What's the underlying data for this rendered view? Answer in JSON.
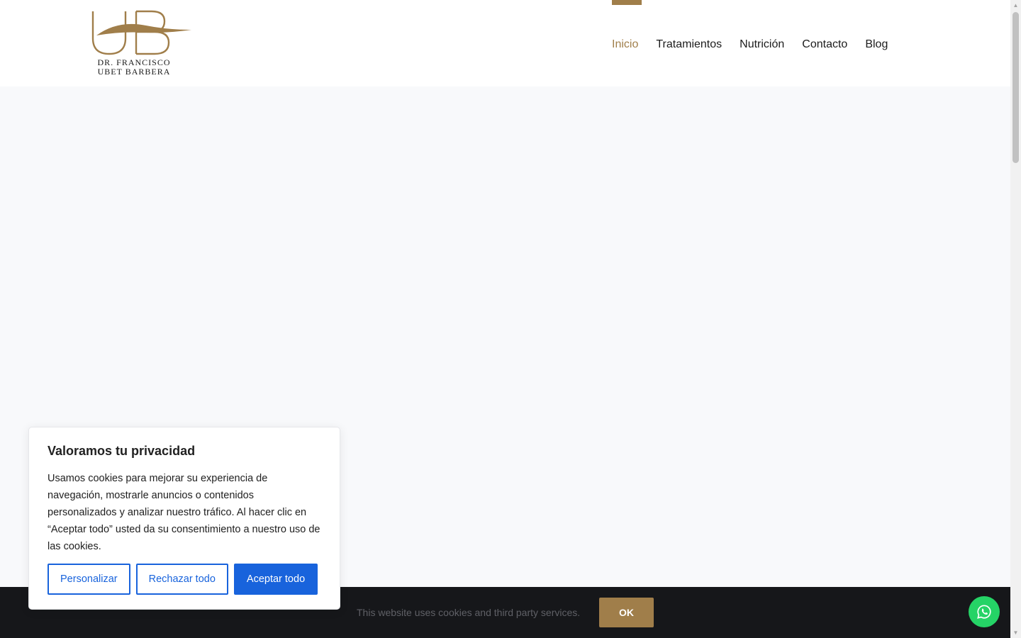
{
  "header": {
    "logo": {
      "monogram": "UB",
      "line1": "DR. FRANCISCO",
      "line2": "UBET BARBERA"
    },
    "nav": [
      {
        "label": "Inicio",
        "active": true
      },
      {
        "label": "Tratamientos",
        "active": false
      },
      {
        "label": "Nutrición",
        "active": false
      },
      {
        "label": "Contacto",
        "active": false
      },
      {
        "label": "Blog",
        "active": false
      }
    ]
  },
  "cookie_bar": {
    "text": "This website uses cookies and third party services.",
    "ok_label": "OK"
  },
  "consent": {
    "title": "Valoramos tu privacidad",
    "body": "Usamos cookies para mejorar su experiencia de navegación, mostrarle anuncios o contenidos personalizados y analizar nuestro tráfico. Al hacer clic en “Aceptar todo” usted da su consentimiento a nuestro uso de las cookies.",
    "customize_label": "Personalizar",
    "reject_label": "Rechazar todo",
    "accept_label": "Aceptar todo"
  },
  "floating": {
    "whatsapp_icon": "whatsapp-icon"
  },
  "colors": {
    "brand_gold": "#a07e4a",
    "consent_blue": "#1863dc",
    "whatsapp_green": "#25d366",
    "dark_bar": "#16171a"
  }
}
